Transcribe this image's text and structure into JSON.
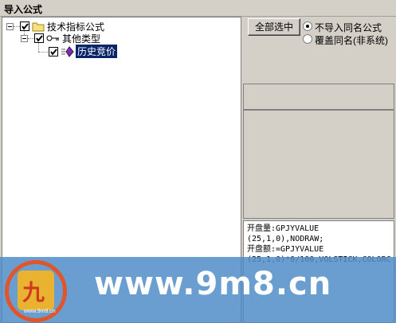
{
  "window": {
    "title": "导入公式"
  },
  "tree": {
    "root": {
      "label": "技术指标公式",
      "checked": true,
      "expanded": true
    },
    "child": {
      "label": "其他类型",
      "checked": true,
      "expanded": true
    },
    "leaf": {
      "label": "历史竞价",
      "checked": true,
      "selected": true
    }
  },
  "options": {
    "select_all_label": "全部选中",
    "radio_no_import": "不导入同名公式",
    "radio_overwrite": "覆盖同名(非系统)",
    "selected": "radio_no_import"
  },
  "preview": {
    "line1": "开盘量:GPJYVALUE",
    "line2": "(25,1,0),NODRAW;",
    "line3": "开盘额:=GPJYVALUE",
    "line4": "(25,1,0)*0/100,VOLSTICK,COLORC"
  },
  "watermark": {
    "url": "www.9m8.cn",
    "logo_char": "九",
    "logo_small": "www.9m8.cn"
  }
}
